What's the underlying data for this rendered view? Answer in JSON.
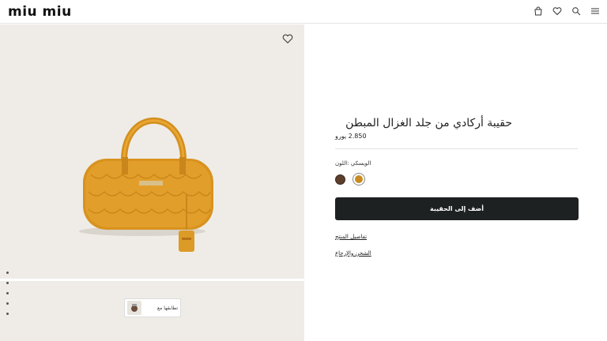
{
  "header": {
    "logo": "miu miu",
    "icons": [
      "bag-icon",
      "heart-icon",
      "search-icon",
      "menu-icon"
    ]
  },
  "gallery": {
    "match_label": "تطابقها مع",
    "dots": 5
  },
  "product": {
    "title": "حقيبة أركادي من جلد الغزال المبطن",
    "price": "2.850 يورو",
    "color_label": "الويسكي :اللون",
    "colors": [
      "#5b3e2c",
      "#c98b21"
    ],
    "add_to_bag": "أضف إلى الحقيبة",
    "details_link": "تفاصيل المنتج",
    "shipping_link": "الشحن والإرجاع"
  },
  "colors": {
    "accent": "#c98b21",
    "button": "#1e2122",
    "image_bg": "#efece7"
  }
}
